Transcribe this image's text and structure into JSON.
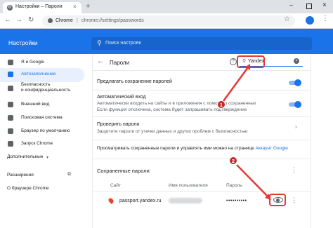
{
  "browser": {
    "tab_title": "Настройки – Пароли",
    "tab_close": "×",
    "new_tab": "+",
    "window_min": "–",
    "window_close": "×",
    "back": "←",
    "forward": "→",
    "reload": "↻",
    "omnibox_site": "Chrome",
    "omnibox_sep": "|",
    "omnibox_url": "chrome://settings/passwords",
    "star": "☆",
    "menu": "⋮"
  },
  "header": {
    "title": "Настройки",
    "search_placeholder": "Поиск настроек",
    "search_icon": "⚲"
  },
  "sidebar": {
    "items": [
      {
        "label": "Я и Google",
        "icon": "person-icon"
      },
      {
        "label": "Автозаполнение",
        "icon": "autofill-icon",
        "active": true
      },
      {
        "label": "Безопасность\nи конфиденциальность",
        "icon": "shield-icon"
      },
      {
        "label": "Внешний вид",
        "icon": "palette-icon"
      },
      {
        "label": "Поисковая система",
        "icon": "search-engine-icon"
      },
      {
        "label": "Браузер по умолчанию",
        "icon": "browser-icon"
      },
      {
        "label": "Запуск Chrome",
        "icon": "power-icon"
      }
    ],
    "additional": "Дополнительные",
    "additional_chevron": "▾",
    "extensions": "Расширения",
    "extensions_icon": "⧉",
    "about": "О браузере Chrome"
  },
  "passwords": {
    "back": "←",
    "title": "Пароли",
    "help": "?",
    "filter_icon": "⚲",
    "filter_value": "Yandex",
    "filter_clear": "×",
    "offer_save": "Предлагать сохранение паролей",
    "autosignin_title": "Автоматический вход",
    "autosignin_desc1": "Автоматически входить на сайты и в приложения с помощью сохраненных",
    "autosignin_desc2": "Если функция отключена, система будет запрашивать подтверждение",
    "check_title": "Проверить пароли",
    "check_desc": "Защитите пароли от утечки данных и других проблем с безопасностью",
    "check_chevron": "›",
    "account_text": "Просматривать сохраненные пароли и управлять ими можно на странице",
    "account_link": "Аккаунт Google",
    "saved_title": "Сохраненные пароли",
    "columns": [
      "Сайт",
      "Имя пользователя",
      "Пароль"
    ],
    "rows": [
      {
        "site": "passport.yandex.ru",
        "password": "••••••••••"
      }
    ],
    "toggles": {
      "offer_save": true,
      "autosignin": true
    }
  },
  "annotations": {
    "step1": "1",
    "step2": "2",
    "color": "#e53935"
  }
}
